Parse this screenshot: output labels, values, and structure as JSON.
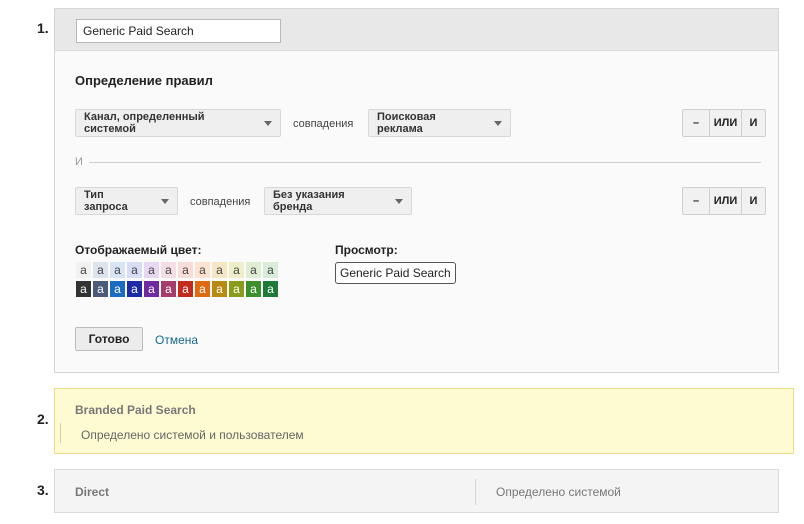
{
  "groups": [
    {
      "number": "1.",
      "name_value": "Generic Paid Search",
      "rules_title": "Определение правил",
      "and_label": "И",
      "rules": [
        {
          "dimension": "Канал, определенный системой",
          "match_text": "совпадения",
          "value": "Поисковая реклама",
          "buttons": {
            "minus": "–",
            "or": "ИЛИ",
            "and": "И"
          }
        },
        {
          "dimension": "Тип запроса",
          "match_text": "совпадения",
          "value": "Без указания бренда",
          "buttons": {
            "minus": "–",
            "or": "ИЛИ",
            "and": "И"
          }
        }
      ],
      "color_title": "Отображаемый цвет:",
      "preview_title": "Просмотр:",
      "preview_text": "Generic Paid Search",
      "swatch_glyph": "a",
      "swatches_light": [
        {
          "bg": "#f1f1f1",
          "fg": "#444444"
        },
        {
          "bg": "#dde3ee",
          "fg": "#444444"
        },
        {
          "bg": "#d6e4f6",
          "fg": "#444444"
        },
        {
          "bg": "#d8dcf5",
          "fg": "#444444"
        },
        {
          "bg": "#e6d8f2",
          "fg": "#444444"
        },
        {
          "bg": "#f4dde5",
          "fg": "#444444"
        },
        {
          "bg": "#f8dcd8",
          "fg": "#444444"
        },
        {
          "bg": "#fbe3cf",
          "fg": "#444444"
        },
        {
          "bg": "#f7e6c4",
          "fg": "#444444"
        },
        {
          "bg": "#eeefc8",
          "fg": "#444444"
        },
        {
          "bg": "#dfeed3",
          "fg": "#444444"
        },
        {
          "bg": "#d9ecd9",
          "fg": "#444444"
        }
      ],
      "swatches_dark": [
        {
          "bg": "#333333",
          "fg": "#ffffff"
        },
        {
          "bg": "#4c5a78",
          "fg": "#ffffff"
        },
        {
          "bg": "#1c6bc2",
          "fg": "#ffffff"
        },
        {
          "bg": "#1e2ba8",
          "fg": "#ffffff"
        },
        {
          "bg": "#6f2aa0",
          "fg": "#ffffff"
        },
        {
          "bg": "#a53d6c",
          "fg": "#ffffff"
        },
        {
          "bg": "#c42b1c",
          "fg": "#ffffff"
        },
        {
          "bg": "#e06a12",
          "fg": "#ffffff"
        },
        {
          "bg": "#b88a10",
          "fg": "#ffffff"
        },
        {
          "bg": "#8b9a1a",
          "fg": "#ffffff"
        },
        {
          "bg": "#3d8f2b",
          "fg": "#ffffff"
        },
        {
          "bg": "#1f7a3a",
          "fg": "#ffffff"
        }
      ],
      "done_label": "Готово",
      "cancel_label": "Отмена"
    },
    {
      "number": "2.",
      "title": "Branded Paid Search",
      "description": "Определено системой и пользователем",
      "highlight_color": "#fefbd3"
    },
    {
      "number": "3.",
      "title": "Direct",
      "description": "Определено системой"
    }
  ]
}
